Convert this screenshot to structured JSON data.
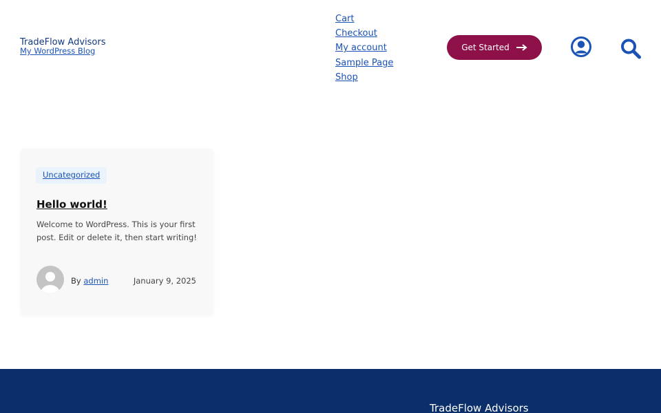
{
  "header": {
    "site_title": "TradeFlow Advisors",
    "site_tagline": "My WordPress Blog",
    "nav": [
      "Cart",
      "Checkout",
      "My account",
      "Sample Page",
      "Shop"
    ],
    "cta_label": "Get Started",
    "account_icon": "user-circle-icon",
    "search_icon": "search-icon"
  },
  "post": {
    "category": "Uncategorized",
    "title": "Hello world!",
    "excerpt": "Welcome to WordPress. This is your first post. Edit or delete it, then start writing!",
    "by_label": "By",
    "author": "admin",
    "date": "January 9, 2025"
  },
  "footer": {
    "title": "TradeFlow Advisors"
  },
  "colors": {
    "link": "#1a53b5",
    "cta_background": "#8d1148",
    "footer_background": "#0b2f6b"
  }
}
